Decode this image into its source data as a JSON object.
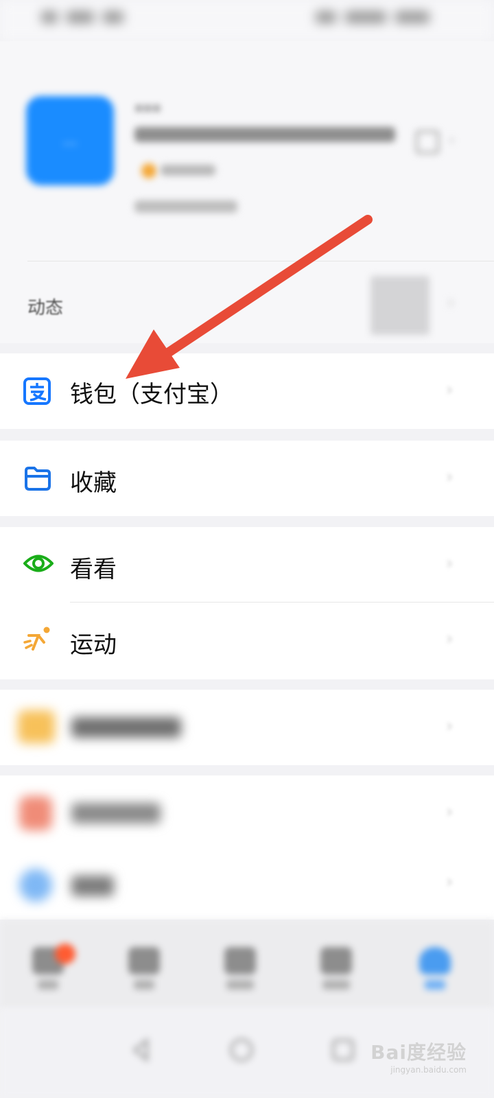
{
  "profile": {
    "avatar_text": "...",
    "nickname": "..."
  },
  "moments": {
    "label": "动态"
  },
  "menu": {
    "wallet_label": "钱包（支付宝）",
    "favorites_label": "收藏",
    "look_label": "看看",
    "sport_label": "运动"
  },
  "watermark": {
    "brand": "Bai度经验",
    "sub": "jingyan.baidu.com"
  },
  "colors": {
    "wallet_blue": "#1677ff",
    "favorites_blue": "#1a73e8",
    "look_green": "#1aad19",
    "sport_orange": "#f4a736",
    "arrow_red": "#e84b37",
    "avatar_blue": "#1a8cff"
  }
}
